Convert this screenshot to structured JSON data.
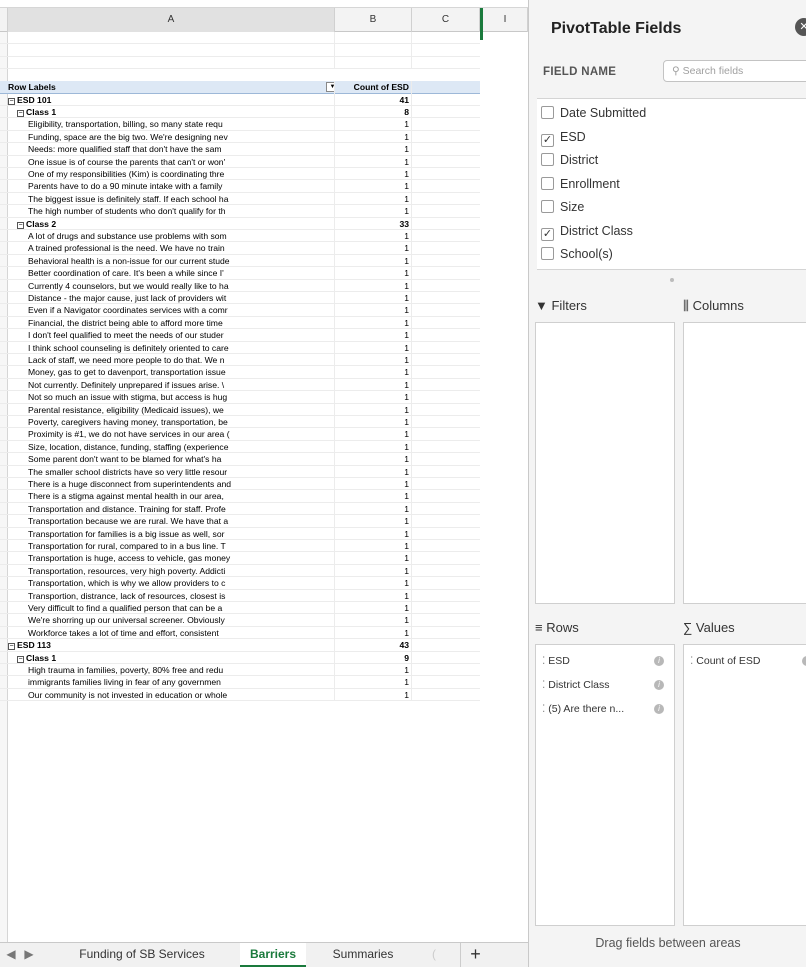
{
  "columns": {
    "a": "A",
    "b": "B",
    "c": "C",
    "d": "I"
  },
  "pivot": {
    "row_labels": "Row Labels",
    "count_header": "Count of ESD",
    "rows": [
      {
        "level": 0,
        "label": "ESD 101",
        "value": "41",
        "toggle": "⊟"
      },
      {
        "level": 1,
        "label": "Class 1",
        "value": "8",
        "toggle": "⊟"
      },
      {
        "level": 2,
        "label": "Eligibility, transportation, billing, so many state requ",
        "value": "1"
      },
      {
        "level": 2,
        "label": "Funding, space are the big two. We're designing nev",
        "value": "1"
      },
      {
        "level": 2,
        "label": "Needs: more qualified staff that don't have the sam",
        "value": "1"
      },
      {
        "level": 2,
        "label": "One issue is of course the parents that can't or won'",
        "value": "1"
      },
      {
        "level": 2,
        "label": "One of my responsibilities (Kim) is coordinating thre",
        "value": "1"
      },
      {
        "level": 2,
        "label": "Parents have to do a 90 minute intake with a family",
        "value": "1"
      },
      {
        "level": 2,
        "label": "The biggest issue is definitely staff. If each school ha",
        "value": "1"
      },
      {
        "level": 2,
        "label": "The high number of students who don't qualify for th",
        "value": "1"
      },
      {
        "level": 1,
        "label": "Class 2",
        "value": "33",
        "toggle": "⊟"
      },
      {
        "level": 2,
        "label": "A lot of drugs and substance use problems with som",
        "value": "1"
      },
      {
        "level": 2,
        "label": "A trained professional is the need. We have no train",
        "value": "1"
      },
      {
        "level": 2,
        "label": "Behavioral health is a non-issue for our current stude",
        "value": "1"
      },
      {
        "level": 2,
        "label": "Better coordination of care. It's been a while since I'",
        "value": "1"
      },
      {
        "level": 2,
        "label": "Currently 4 counselors, but we would really like to ha",
        "value": "1"
      },
      {
        "level": 2,
        "label": "Distance - the major cause, just lack of providers wit",
        "value": "1"
      },
      {
        "level": 2,
        "label": "Even if a Navigator coordinates services with a comr",
        "value": "1"
      },
      {
        "level": 2,
        "label": "Financial, the district being able to afford more time",
        "value": "1"
      },
      {
        "level": 2,
        "label": "I don't feel qualified to meet the needs of our studer",
        "value": "1"
      },
      {
        "level": 2,
        "label": "I think school counseling is definitely oriented to care",
        "value": "1"
      },
      {
        "level": 2,
        "label": "Lack of staff, we need more people to do that. We n",
        "value": "1"
      },
      {
        "level": 2,
        "label": "Money, gas to get to davenport, transportation issue",
        "value": "1"
      },
      {
        "level": 2,
        "label": "Not currently. Definitely unprepared if issues arise. \\",
        "value": "1"
      },
      {
        "level": 2,
        "label": "Not so much an issue with stigma, but access is hug",
        "value": "1"
      },
      {
        "level": 2,
        "label": "Parental resistance, eligibility (Medicaid issues), we",
        "value": "1"
      },
      {
        "level": 2,
        "label": "Poverty, caregivers having money, transportation, be",
        "value": "1"
      },
      {
        "level": 2,
        "label": "Proximity is #1, we do not have services in our area (",
        "value": "1"
      },
      {
        "level": 2,
        "label": "Size, location, distance, funding, staffing (experience",
        "value": "1"
      },
      {
        "level": 2,
        "label": "Some parent don't want to be blamed for what's ha",
        "value": "1"
      },
      {
        "level": 2,
        "label": "The smaller school districts have so very little resour",
        "value": "1"
      },
      {
        "level": 2,
        "label": "There is a huge disconnect from superintendents and",
        "value": "1"
      },
      {
        "level": 2,
        "label": "There is a stigma against mental health in our area,",
        "value": "1"
      },
      {
        "level": 2,
        "label": "Transportation and distance. Training for staff. Profe",
        "value": "1"
      },
      {
        "level": 2,
        "label": "Transportation because we are rural. We have that a",
        "value": "1"
      },
      {
        "level": 2,
        "label": "Transportation for families is a big issue as well, sor",
        "value": "1"
      },
      {
        "level": 2,
        "label": "Transportation for rural, compared to in a bus line. T",
        "value": "1"
      },
      {
        "level": 2,
        "label": "Transportation is huge, access to vehicle, gas money",
        "value": "1"
      },
      {
        "level": 2,
        "label": "Transportation, resources, very high poverty. Addicti",
        "value": "1"
      },
      {
        "level": 2,
        "label": "Transportation, which is why we allow providers to c",
        "value": "1"
      },
      {
        "level": 2,
        "label": "Transportion, distrance, lack of resources, closest is",
        "value": "1"
      },
      {
        "level": 2,
        "label": "Very difficult to find a qualified person that can be a",
        "value": "1"
      },
      {
        "level": 2,
        "label": "We're shorring up our universal screener. Obviously",
        "value": "1"
      },
      {
        "level": 2,
        "label": "Workforce takes a lot of time and effort, consistent",
        "value": "1"
      },
      {
        "level": 0,
        "label": "ESD 113",
        "value": "43",
        "toggle": "⊟"
      },
      {
        "level": 1,
        "label": "Class 1",
        "value": "9",
        "toggle": "⊟"
      },
      {
        "level": 2,
        "label": "High trauma in families, poverty, 80% free and redu",
        "value": "1"
      },
      {
        "level": 2,
        "label": "immigrants families living in fear of any governmen",
        "value": "1"
      },
      {
        "level": 2,
        "label": "Our community is not invested in education or whole",
        "value": "1"
      }
    ]
  },
  "tabs": [
    {
      "label": "Funding of SB Services",
      "active": false
    },
    {
      "label": "Barriers",
      "active": true
    },
    {
      "label": "Summaries",
      "active": false
    }
  ],
  "panel": {
    "title": "PivotTable Fields",
    "field_name": "FIELD NAME",
    "search_placeholder": "Search fields",
    "fields": [
      {
        "label": "Date Submitted",
        "checked": false
      },
      {
        "label": "ESD",
        "checked": true
      },
      {
        "label": "District",
        "checked": false
      },
      {
        "label": "Enrollment",
        "checked": false
      },
      {
        "label": "Size",
        "checked": false
      },
      {
        "label": "District Class",
        "checked": true
      },
      {
        "label": "School(s)",
        "checked": false
      }
    ],
    "filters": "Filters",
    "columns": "Columns",
    "rows": "Rows",
    "values": "Values",
    "row_items": [
      "ESD",
      "District Class",
      "(5) Are there n..."
    ],
    "value_items": [
      "Count of ESD"
    ],
    "drag_hint": "Drag fields between areas"
  }
}
